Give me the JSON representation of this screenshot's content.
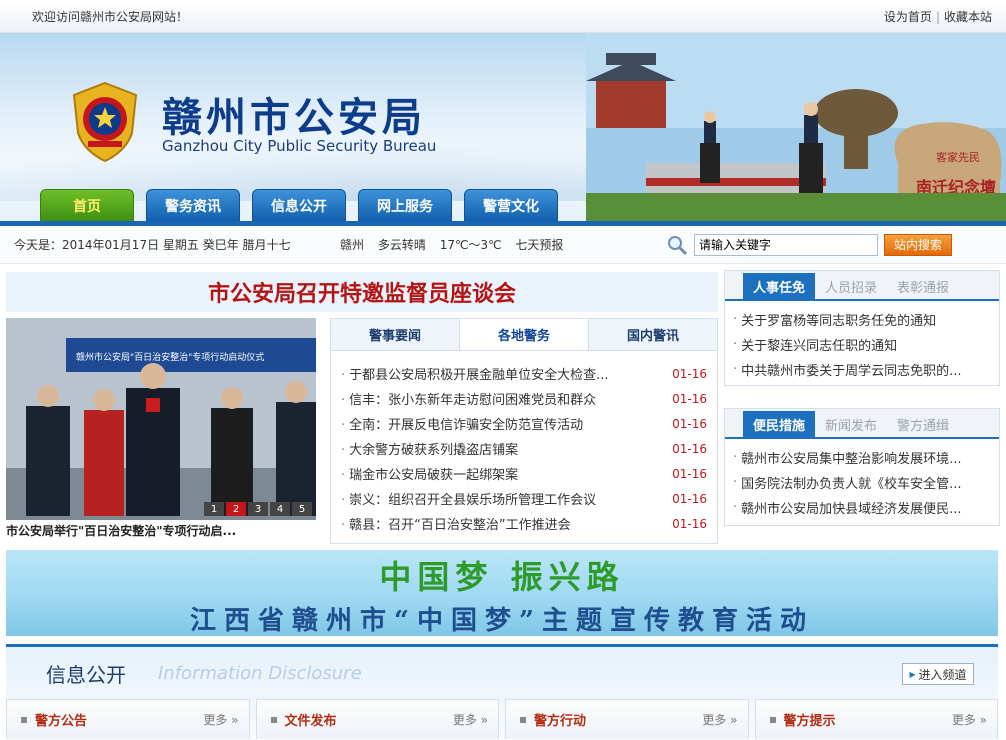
{
  "topbar": {
    "welcome": "欢迎访问赣州市公安局网站！",
    "set_home": "设为首页",
    "separator": "|",
    "bookmark": "收藏本站"
  },
  "header": {
    "title_cn": "赣州市公安局",
    "title_en": "Ganzhou City Public Security Bureau",
    "stone_top": "客家先民",
    "stone_main": "南迁纪念壇"
  },
  "nav": [
    {
      "label": "首页",
      "active": true
    },
    {
      "label": "警务资讯",
      "active": false
    },
    {
      "label": "信息公开",
      "active": false
    },
    {
      "label": "网上服务",
      "active": false
    },
    {
      "label": "警营文化",
      "active": false
    }
  ],
  "infobar": {
    "date": "今天是：2014年01月17日 星期五 癸巳年 腊月十七",
    "weather_city": "赣州",
    "weather_desc": "多云转晴",
    "weather_temp": "17℃～3℃",
    "weather_link": "七天预报",
    "search_placeholder": "请输入关键字",
    "search_value": "请输入关键字",
    "search_button": "站内搜索"
  },
  "headline": "市公安局召开特邀监督员座谈会",
  "photo": {
    "banner_text": "赣州市公安局\"百日治安整治\"专项行动启动仪式",
    "caption": "市公安局举行\"百日治安整治\"专项行动启...",
    "pages": [
      "1",
      "2",
      "3",
      "4",
      "5"
    ]
  },
  "news": {
    "tabs": [
      "警事要闻",
      "各地警务",
      "国内警讯"
    ],
    "items": [
      {
        "title": "于都县公安局积极开展金融单位安全大检查...",
        "date": "01-16"
      },
      {
        "title": "信丰：张小东新年走访慰问困难党员和群众",
        "date": "01-16"
      },
      {
        "title": "全南：开展反电信诈骗安全防范宣传活动",
        "date": "01-16"
      },
      {
        "title": "大余警方破获系列撬盗店铺案",
        "date": "01-16"
      },
      {
        "title": "瑞金市公安局破获一起绑架案",
        "date": "01-16"
      },
      {
        "title": "崇义：组织召开全县娱乐场所管理工作会议",
        "date": "01-16"
      },
      {
        "title": "赣县：召开“百日治安整治”工作推进会",
        "date": "01-16"
      }
    ]
  },
  "personnel": {
    "tabs": [
      "人事任免",
      "人员招录",
      "表彰通报"
    ],
    "items": [
      "关于罗富杨等同志职务任免的通知",
      "关于黎连兴同志任职的通知",
      "中共赣州市委关于周学云同志免职的..."
    ]
  },
  "convenience": {
    "tabs": [
      "便民措施",
      "新闻发布",
      "警方通缉"
    ],
    "items": [
      "赣州市公安局集中整治影响发展环境...",
      "国务院法制办负责人就《校车安全管...",
      "赣州市公安局加快县域经济发展便民..."
    ]
  },
  "banner": {
    "line1": "中国梦  振兴路",
    "line2": "江西省赣州市“中国梦”主题宣传教育活动"
  },
  "disclosure": {
    "title": "信息公开",
    "title_en": "Information Disclosure",
    "enter": "进入频道",
    "more": "更多 »",
    "columns": [
      "警方公告",
      "文件发布",
      "警方行动",
      "警方提示"
    ]
  }
}
